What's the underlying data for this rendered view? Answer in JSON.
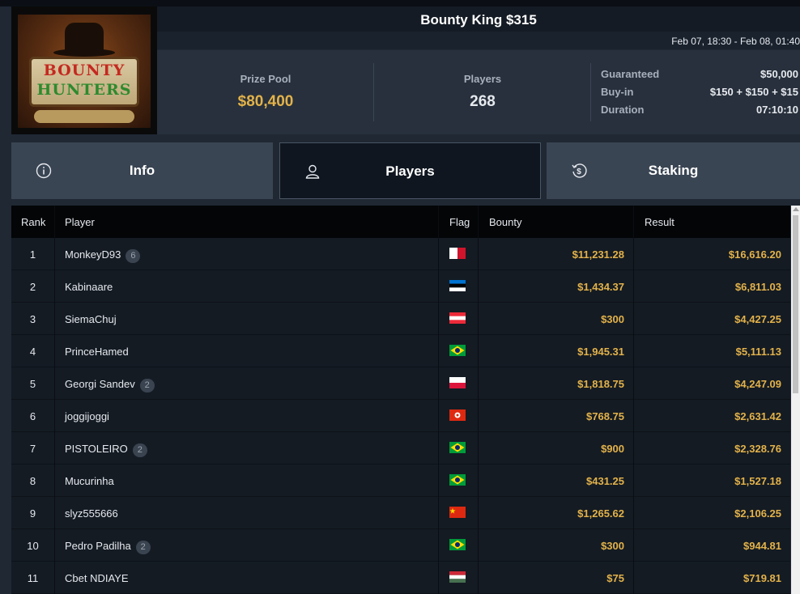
{
  "logo": {
    "line1": "BOUNTY",
    "line2": "HUNTERS"
  },
  "tournament": {
    "title": "Bounty King $315",
    "date_range": "Feb 07, 18:30 - Feb 08, 01:40"
  },
  "stats": {
    "prize_pool_label": "Prize Pool",
    "prize_pool_value": "$80,400",
    "players_label": "Players",
    "players_value": "268"
  },
  "details": {
    "guaranteed_label": "Guaranteed",
    "guaranteed_value": "$50,000",
    "buyin_label": "Buy-in",
    "buyin_value": "$150 + $150 + $15",
    "duration_label": "Duration",
    "duration_value": "07:10:10"
  },
  "tabs": [
    {
      "label": "Info",
      "icon": "info-icon"
    },
    {
      "label": "Players",
      "icon": "user-icon"
    },
    {
      "label": "Staking",
      "icon": "dollar-cycle-icon"
    }
  ],
  "table": {
    "headers": {
      "rank": "Rank",
      "player": "Player",
      "flag": "Flag",
      "bounty": "Bounty",
      "result": "Result"
    },
    "rows": [
      {
        "rank": "1",
        "player": "MonkeyD93",
        "count": "6",
        "flag": "malta",
        "bounty": "$11,231.28",
        "result": "$16,616.20"
      },
      {
        "rank": "2",
        "player": "Kabinaare",
        "count": "",
        "flag": "estonia",
        "bounty": "$1,434.37",
        "result": "$6,811.03"
      },
      {
        "rank": "3",
        "player": "SiemaChuj",
        "count": "",
        "flag": "austria",
        "bounty": "$300",
        "result": "$4,427.25"
      },
      {
        "rank": "4",
        "player": "PrinceHamed",
        "count": "",
        "flag": "brazil",
        "bounty": "$1,945.31",
        "result": "$5,111.13"
      },
      {
        "rank": "5",
        "player": "Georgi Sandev",
        "count": "2",
        "flag": "poland",
        "bounty": "$1,818.75",
        "result": "$4,247.09"
      },
      {
        "rank": "6",
        "player": "joggijoggi",
        "count": "",
        "flag": "hong-kong",
        "bounty": "$768.75",
        "result": "$2,631.42"
      },
      {
        "rank": "7",
        "player": "PISTOLEIRO",
        "count": "2",
        "flag": "brazil",
        "bounty": "$900",
        "result": "$2,328.76"
      },
      {
        "rank": "8",
        "player": "Mucurinha",
        "count": "",
        "flag": "brazil",
        "bounty": "$431.25",
        "result": "$1,527.18"
      },
      {
        "rank": "9",
        "player": "slyz555666",
        "count": "",
        "flag": "china",
        "bounty": "$1,265.62",
        "result": "$2,106.25"
      },
      {
        "rank": "10",
        "player": "Pedro Padilha",
        "count": "2",
        "flag": "brazil",
        "bounty": "$300",
        "result": "$944.81"
      },
      {
        "rank": "11",
        "player": "Cbet NDIAYE",
        "count": "",
        "flag": "hungary",
        "bounty": "$75",
        "result": "$719.81"
      }
    ]
  },
  "colors": {
    "accent_gold": "#e3b24a",
    "background": "#1f2833",
    "tab_active": "#0f1620"
  }
}
